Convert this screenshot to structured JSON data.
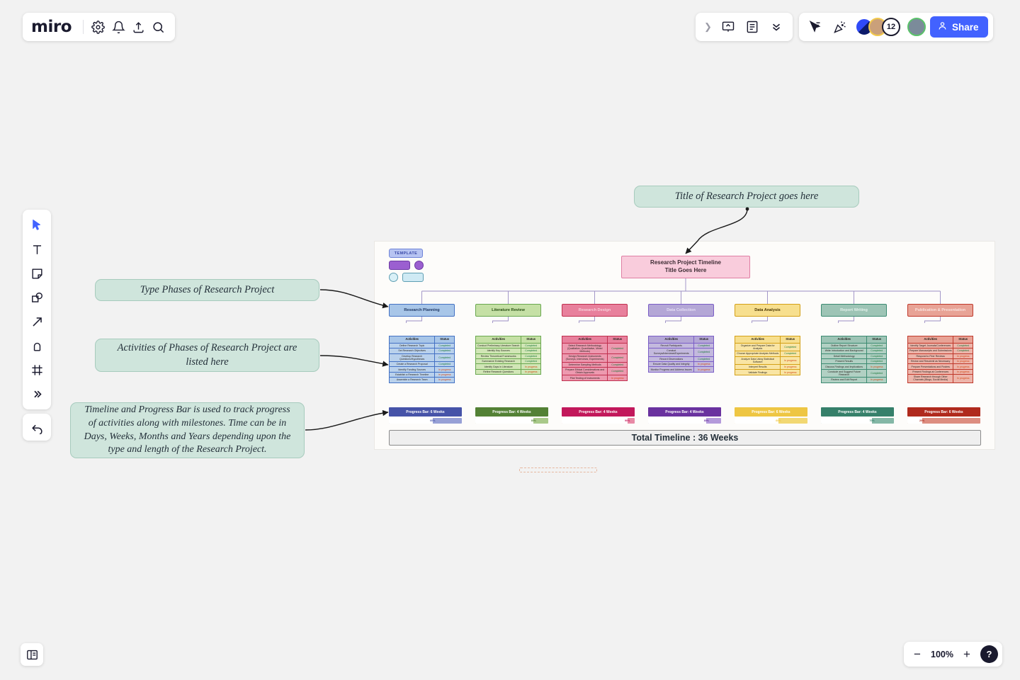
{
  "app": {
    "brand": "miro",
    "topbar_left_icons": [
      "settings-gear-icon",
      "bell-icon",
      "upload-icon",
      "search-icon"
    ],
    "topbar_mid_icons": [
      "chevron-right-icon",
      "presentation-icon",
      "notes-icon",
      "chevron-double-down-icon"
    ],
    "topbar_right_icons": [
      "cursor-share-icon",
      "celebrate-icon"
    ],
    "avatars": [
      {
        "name": "avatar-blue",
        "label": ""
      },
      {
        "name": "avatar-user-1",
        "label": ""
      },
      {
        "name": "avatar-overflow-count",
        "label": "12"
      },
      {
        "name": "avatar-user-2",
        "label": ""
      }
    ],
    "share_label": "Share"
  },
  "tools": [
    {
      "name": "select-tool",
      "icon": "cursor-icon",
      "active": true
    },
    {
      "name": "text-tool",
      "icon": "text-icon",
      "active": false
    },
    {
      "name": "sticky-note-tool",
      "icon": "sticky-note-icon",
      "active": false
    },
    {
      "name": "shapes-tool",
      "icon": "shapes-icon",
      "active": false
    },
    {
      "name": "connection-line-tool",
      "icon": "arrow-icon",
      "active": false
    },
    {
      "name": "pen-tool",
      "icon": "pen-icon",
      "active": false
    },
    {
      "name": "frame-tool",
      "icon": "frame-icon",
      "active": false
    },
    {
      "name": "more-tools",
      "icon": "chevron-double-right-icon",
      "active": false
    }
  ],
  "undo_label": "undo-icon",
  "bottom": {
    "panel_toggle": "panel-toggle-icon",
    "zoom_out": "−",
    "zoom_value": "100%",
    "zoom_in": "+",
    "help": "?"
  },
  "notes": {
    "title": "Title of Research Project goes here",
    "phases": "Type Phases of Research Project",
    "activities": "Activities of Phases of Research Project are listed here",
    "timeline": "Timeline and Progress Bar is used to track progress of activities along with milestones. Time can be in Days, Weeks, Months and Years depending upon the type and length of the Research Project."
  },
  "board": {
    "legend_label": "TEMPLATE",
    "root_title": "Research Project Timeline\nTitle Goes Here",
    "root_title_line1": "Research Project Timeline",
    "root_title_line2": "Title Goes Here",
    "col_header_activities": "Activities",
    "col_header_status": "Status",
    "total_timeline": "Total Timeline : 36 Weeks",
    "status_done": "Completed",
    "status_progress": "In progress"
  },
  "chart_data": {
    "type": "table",
    "title": "Research Project Timeline",
    "total_timeline_weeks": 36,
    "phases": [
      {
        "name": "Research Planning",
        "color": "#a8c6e8",
        "border": "#4472c4",
        "head_text": "#1f3864",
        "bar_color": "#4653a8",
        "bar_track": "#97a0d6",
        "duration": "Progress Bar: 6 Weeks",
        "weeks": 6,
        "progress_pct": 60,
        "progress_label": "60%",
        "activities": [
          {
            "name": "Define Research Topic",
            "status": "Completed"
          },
          {
            "name": "Set Research Objectives",
            "status": "Completed"
          },
          {
            "name": "Develop Research Questions/Hypotheses",
            "status": "Completed"
          },
          {
            "name": "Create a Research Proposal",
            "status": "Completed"
          },
          {
            "name": "Identify Funding Sources",
            "status": "In progress"
          },
          {
            "name": "Establish a Research Timeline",
            "status": "In progress"
          },
          {
            "name": "Assemble a Research Team",
            "status": "In progress"
          }
        ]
      },
      {
        "name": "Literature Review",
        "color": "#c5e0a5",
        "border": "#6aa84f",
        "head_text": "#274e13",
        "bar_color": "#538135",
        "bar_track": "#a9c98a",
        "duration": "Progress Bar: 4 Weeks",
        "weeks": 4,
        "progress_pct": 80,
        "progress_label": "80%",
        "activities": [
          {
            "name": "Conduct Preliminary Literature Search",
            "status": "Completed"
          },
          {
            "name": "Identify Key Sources",
            "status": "Completed"
          },
          {
            "name": "Review Theoretical Frameworks",
            "status": "Completed"
          },
          {
            "name": "Summarize Existing Research",
            "status": "Completed"
          },
          {
            "name": "Identify Gaps in Literature",
            "status": "In progress"
          },
          {
            "name": "Refine Research Questions",
            "status": "In progress"
          }
        ]
      },
      {
        "name": "Research Design",
        "color": "#e8809c",
        "border": "#c0304f",
        "head_text": "#f7d0da",
        "bar_color": "#c2185b",
        "bar_track": "#e88aa6",
        "duration": "Progress Bar: 4 Weeks",
        "weeks": 4,
        "progress_pct": 90,
        "progress_label": "90%",
        "activities": [
          {
            "name": "Select Research Methodology (Qualitative, Quantitative, Mixed Methods)",
            "status": "Completed"
          },
          {
            "name": "Design Research Instruments (Surveys, Interviews, Experiments)",
            "status": "Completed"
          },
          {
            "name": "Determine Sampling Methods",
            "status": "Completed"
          },
          {
            "name": "Prepare Ethical Considerations and Obtain Approvals",
            "status": "Completed"
          },
          {
            "name": "Pilot Testing of Instruments",
            "status": "In progress"
          }
        ]
      },
      {
        "name": "Data Collection",
        "color": "#b4a7d6",
        "border": "#7b5ec7",
        "head_text": "#e6dff5",
        "bar_color": "#6a329f",
        "bar_track": "#b49adb",
        "duration": "Progress Bar: 4 Weeks",
        "weeks": 4,
        "progress_pct": 80,
        "progress_label": "80%",
        "activities": [
          {
            "name": "Recruit Participants",
            "status": "Completed"
          },
          {
            "name": "Conduct Surveys/Interviews/Experiments",
            "status": "Completed"
          },
          {
            "name": "Record Observations",
            "status": "Completed"
          },
          {
            "name": "Ensure Data Quality and Integrity",
            "status": "In progress"
          },
          {
            "name": "Monitor Progress and Address Issues",
            "status": "In progress"
          }
        ]
      },
      {
        "name": "Data Analysis",
        "color": "#f7df8e",
        "border": "#d4a017",
        "head_text": "#4a3500",
        "bar_color": "#eec643",
        "bar_track": "#f2d873",
        "duration": "Progress Bar: 6 Weeks",
        "weeks": 6,
        "progress_pct": 60,
        "progress_label": "60%",
        "activities": [
          {
            "name": "Organize and Prepare Data for Analysis",
            "status": "Completed"
          },
          {
            "name": "Choose Appropriate Analysis Methods",
            "status": "Completed"
          },
          {
            "name": "Analyze Data Using Statistical Software",
            "status": "In progress"
          },
          {
            "name": "Interpret Results",
            "status": "In progress"
          },
          {
            "name": "Validate Findings",
            "status": "In progress"
          }
        ]
      },
      {
        "name": "Report Writing",
        "color": "#9dc4b5",
        "border": "#3d8b72",
        "head_text": "#e4f2ec",
        "bar_color": "#36806a",
        "bar_track": "#84b7a6",
        "duration": "Progress Bar: 4 Weeks",
        "weeks": 4,
        "progress_pct": 70,
        "progress_label": "70%",
        "activities": [
          {
            "name": "Outline Report Structure",
            "status": "Completed"
          },
          {
            "name": "Write Introduction and Background",
            "status": "Completed"
          },
          {
            "name": "Detail Methodology",
            "status": "Completed"
          },
          {
            "name": "Present Results",
            "status": "Completed"
          },
          {
            "name": "Discuss Findings and Implications",
            "status": "In progress"
          },
          {
            "name": "Conclude and Suggest Future Research",
            "status": "Completed"
          },
          {
            "name": "Review and Edit Report",
            "status": "In progress"
          }
        ]
      },
      {
        "name": "Publication & Presentation",
        "color": "#e8a396",
        "border": "#c0392b",
        "head_text": "#fae3de",
        "bar_color": "#b02a1d",
        "bar_track": "#dd8d80",
        "duration": "Progress Bar: 6 Weeks",
        "weeks": 6,
        "progress_pct": 20,
        "progress_label": "20%",
        "activities": [
          {
            "name": "Identify Target Journals/Conferences",
            "status": "Completed"
          },
          {
            "name": "Prepare Manuscripts and Submissions",
            "status": "Completed"
          },
          {
            "name": "Respond to Peer Reviews",
            "status": "In progress"
          },
          {
            "name": "Revise and Resubmit as Necessary",
            "status": "In progress"
          },
          {
            "name": "Prepare Presentations and Posters",
            "status": "In progress"
          },
          {
            "name": "Present Findings at Conferences",
            "status": "In progress"
          },
          {
            "name": "Share Research through Other Channels (Blogs, Social Media)",
            "status": "In progress"
          }
        ]
      }
    ]
  }
}
